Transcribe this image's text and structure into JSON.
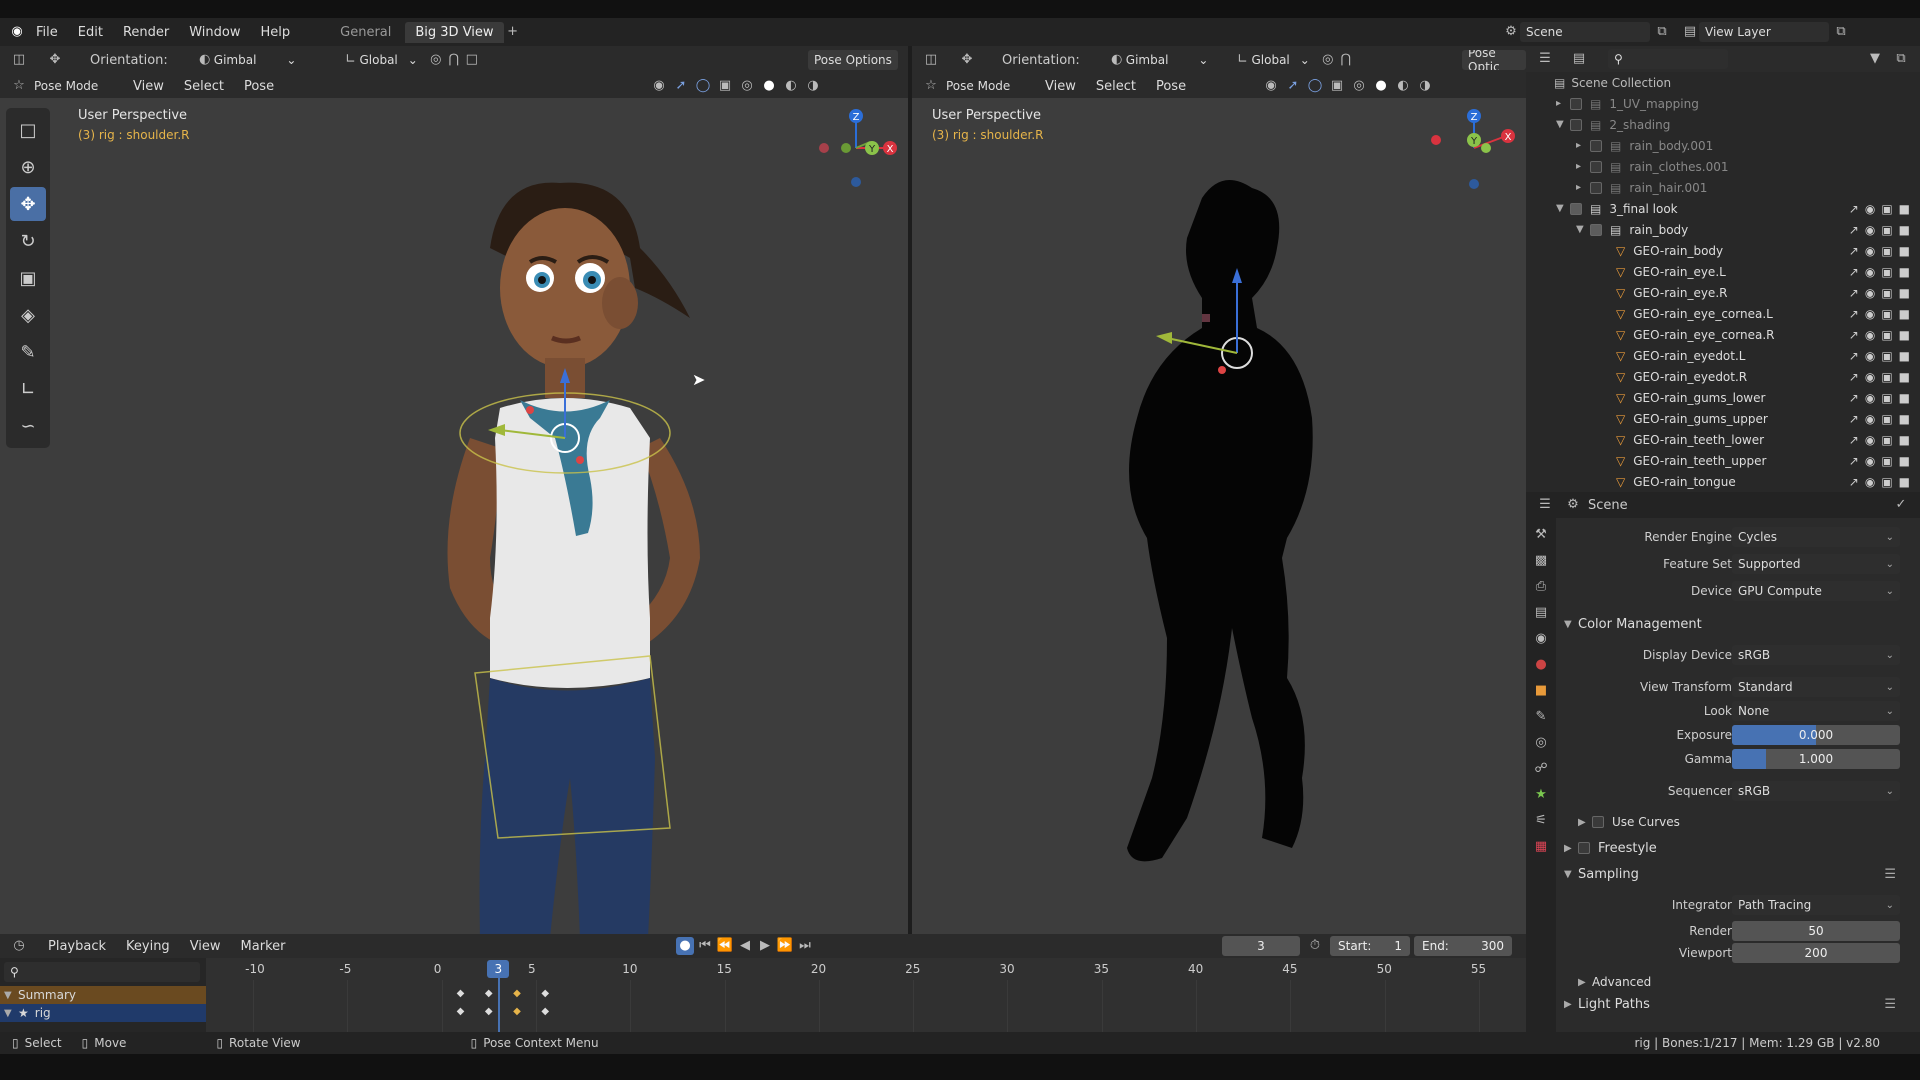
{
  "menu": {
    "items": [
      "File",
      "Edit",
      "Render",
      "Window",
      "Help"
    ]
  },
  "workspace_tabs": [
    "General",
    "Big 3D View"
  ],
  "scene_selector": {
    "label": "Scene"
  },
  "view_layer": {
    "label": "View Layer"
  },
  "viewport_header": {
    "orientation_label": "Orientation:",
    "orientation_value": "Gimbal",
    "transform_value": "Global",
    "pose_options": "Pose Options",
    "pose_options_short": "Pose Optic",
    "mode": "Pose Mode",
    "menus": [
      "View",
      "Select",
      "Pose"
    ]
  },
  "viewports": [
    {
      "title": "User Perspective",
      "subtitle": "(3) rig : shoulder.R"
    },
    {
      "title": "User Perspective",
      "subtitle": "(3) rig : shoulder.R"
    }
  ],
  "gizmo": {
    "x": "X",
    "y": "Y",
    "z": "Z"
  },
  "outliner": {
    "root": "Scene Collection",
    "items": [
      {
        "name": "1_UV_mapping",
        "indent": 1,
        "checked": false,
        "type": "collection",
        "dim": true
      },
      {
        "name": "2_shading",
        "indent": 1,
        "checked": false,
        "type": "collection",
        "dim": true,
        "expanded": true
      },
      {
        "name": "rain_body.001",
        "indent": 2,
        "checked": false,
        "type": "collection",
        "dim": true
      },
      {
        "name": "rain_clothes.001",
        "indent": 2,
        "checked": false,
        "type": "collection",
        "dim": true
      },
      {
        "name": "rain_hair.001",
        "indent": 2,
        "checked": false,
        "type": "collection",
        "dim": true
      },
      {
        "name": "3_final look",
        "indent": 1,
        "checked": true,
        "type": "collection",
        "dim": false,
        "expanded": true
      },
      {
        "name": "rain_body",
        "indent": 2,
        "checked": true,
        "type": "collection",
        "dim": false,
        "expanded": true
      },
      {
        "name": "GEO-rain_body",
        "indent": 3,
        "type": "mesh"
      },
      {
        "name": "GEO-rain_eye.L",
        "indent": 3,
        "type": "mesh"
      },
      {
        "name": "GEO-rain_eye.R",
        "indent": 3,
        "type": "mesh"
      },
      {
        "name": "GEO-rain_eye_cornea.L",
        "indent": 3,
        "type": "mesh"
      },
      {
        "name": "GEO-rain_eye_cornea.R",
        "indent": 3,
        "type": "mesh"
      },
      {
        "name": "GEO-rain_eyedot.L",
        "indent": 3,
        "type": "mesh"
      },
      {
        "name": "GEO-rain_eyedot.R",
        "indent": 3,
        "type": "mesh"
      },
      {
        "name": "GEO-rain_gums_lower",
        "indent": 3,
        "type": "mesh"
      },
      {
        "name": "GEO-rain_gums_upper",
        "indent": 3,
        "type": "mesh"
      },
      {
        "name": "GEO-rain_teeth_lower",
        "indent": 3,
        "type": "mesh"
      },
      {
        "name": "GEO-rain_teeth_upper",
        "indent": 3,
        "type": "mesh"
      },
      {
        "name": "GEO-rain_tongue",
        "indent": 3,
        "type": "mesh"
      }
    ]
  },
  "properties": {
    "context": "Scene",
    "render_engine": {
      "label": "Render Engine",
      "value": "Cycles"
    },
    "feature_set": {
      "label": "Feature Set",
      "value": "Supported"
    },
    "device": {
      "label": "Device",
      "value": "GPU Compute"
    },
    "color_management": {
      "title": "Color Management",
      "display_device": {
        "label": "Display Device",
        "value": "sRGB"
      },
      "view_transform": {
        "label": "View Transform",
        "value": "Standard"
      },
      "look": {
        "label": "Look",
        "value": "None"
      },
      "exposure": {
        "label": "Exposure",
        "value": "0.000",
        "fill": 0.5
      },
      "gamma": {
        "label": "Gamma",
        "value": "1.000",
        "fill": 0.2
      },
      "sequencer": {
        "label": "Sequencer",
        "value": "sRGB"
      },
      "use_curves": "Use Curves"
    },
    "freestyle": "Freestyle",
    "sampling": {
      "title": "Sampling",
      "integrator": {
        "label": "Integrator",
        "value": "Path Tracing"
      },
      "render": {
        "label": "Render",
        "value": "50"
      },
      "viewport": {
        "label": "Viewport",
        "value": "200"
      },
      "advanced": "Advanced"
    },
    "light_paths": "Light Paths"
  },
  "timeline": {
    "menus": [
      "Playback",
      "Keying",
      "View",
      "Marker"
    ],
    "current_frame": "3",
    "start_label": "Start:",
    "start_value": "1",
    "end_label": "End:",
    "end_value": "300",
    "ruler": [
      "-10",
      "-5",
      "0",
      "5",
      "10",
      "15",
      "20",
      "25",
      "30",
      "35",
      "40",
      "45",
      "50",
      "55"
    ],
    "channels": [
      "Summary",
      "rig"
    ]
  },
  "statusbar": {
    "select": "Select",
    "move": "Move",
    "rotate": "Rotate View",
    "context": "Pose Context Menu",
    "info": "rig | Bones:1/217 | Mem: 1.29 GB | v2.80"
  },
  "colors": {
    "accent": "#4772b3",
    "orange": "#e6b44a"
  }
}
